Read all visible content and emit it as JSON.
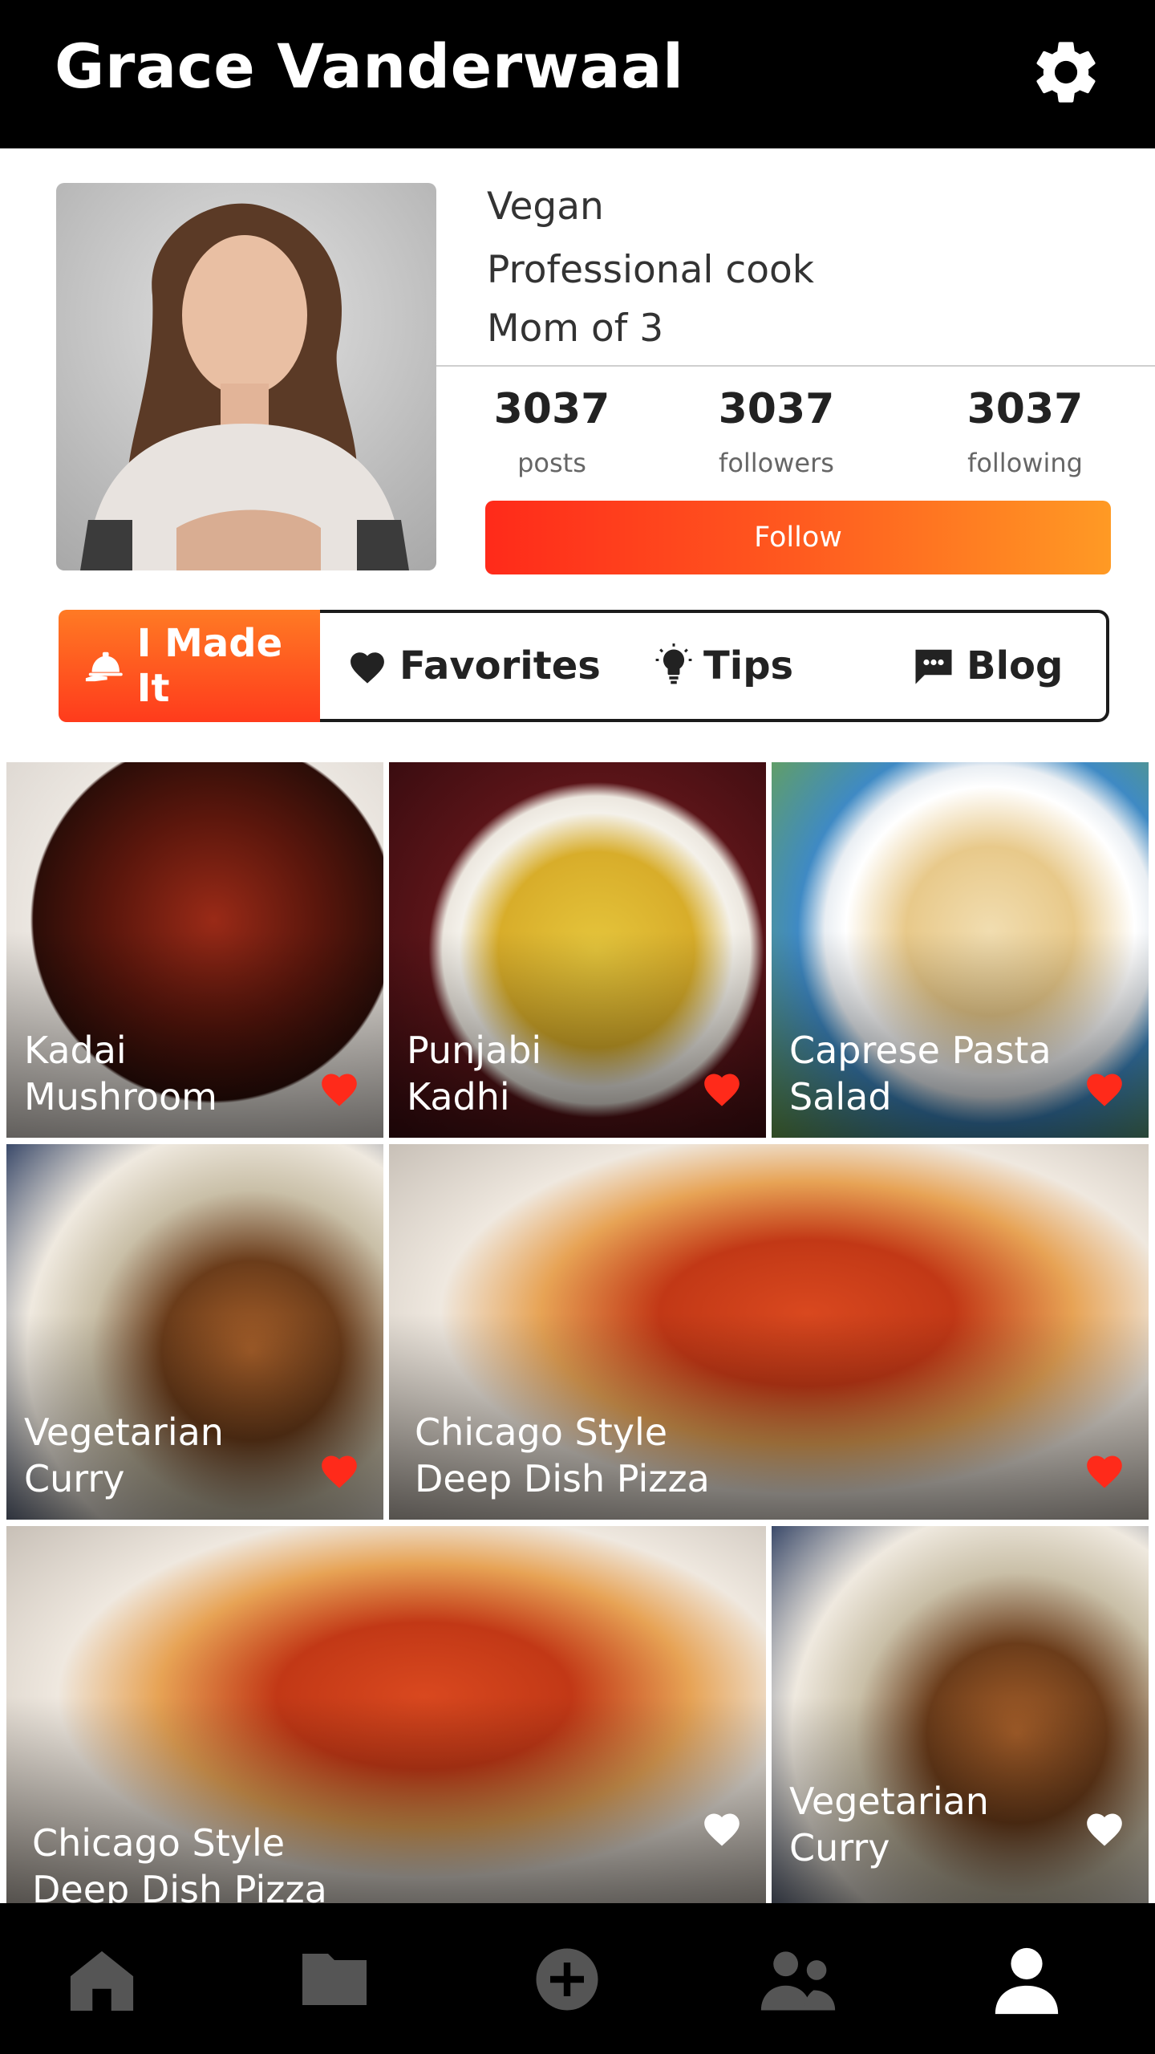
{
  "header": {
    "title": "Grace Vanderwaal",
    "settings_icon": "gear-icon"
  },
  "profile": {
    "bio": [
      "Vegan",
      "Professional cook",
      "Mom of 3"
    ],
    "stats": [
      {
        "value": "3037",
        "label": "posts"
      },
      {
        "value": "3037",
        "label": "followers"
      },
      {
        "value": "3037",
        "label": "following"
      }
    ],
    "follow_label": "Follow"
  },
  "tabs": [
    {
      "label": "I Made It",
      "icon": "serving-cloche-icon",
      "active": true
    },
    {
      "label": "Favorites",
      "icon": "heart-icon",
      "active": false
    },
    {
      "label": "Tips",
      "icon": "lightbulb-icon",
      "active": false
    },
    {
      "label": "Blog",
      "icon": "chat-bubble-icon",
      "active": false
    }
  ],
  "recipes": [
    {
      "title": "Kadai\nMushroom",
      "liked": true
    },
    {
      "title": "Punjabi\nKadhi",
      "liked": true
    },
    {
      "title": "Caprese Pasta\nSalad",
      "liked": true
    },
    {
      "title": "Vegetarian\nCurry",
      "liked": true
    },
    {
      "title": "Chicago Style\nDeep Dish Pizza",
      "liked": true
    },
    {
      "title": "Chicago Style\nDeep Dish Pizza",
      "liked": false
    },
    {
      "title": "Vegetarian\nCurry",
      "liked": false
    }
  ],
  "bottom_nav": [
    {
      "icon": "home-icon",
      "active": false
    },
    {
      "icon": "folder-icon",
      "active": false
    },
    {
      "icon": "add-circle-icon",
      "active": false
    },
    {
      "icon": "people-icon",
      "active": false
    },
    {
      "icon": "profile-icon",
      "active": true
    }
  ],
  "colors": {
    "accent_start": "#ff2a1a",
    "accent_end": "#ff9a24",
    "heart_liked": "#ff2a1a",
    "heart_unliked": "#ffffff",
    "nav_inactive": "#555555",
    "nav_active": "#ffffff"
  }
}
